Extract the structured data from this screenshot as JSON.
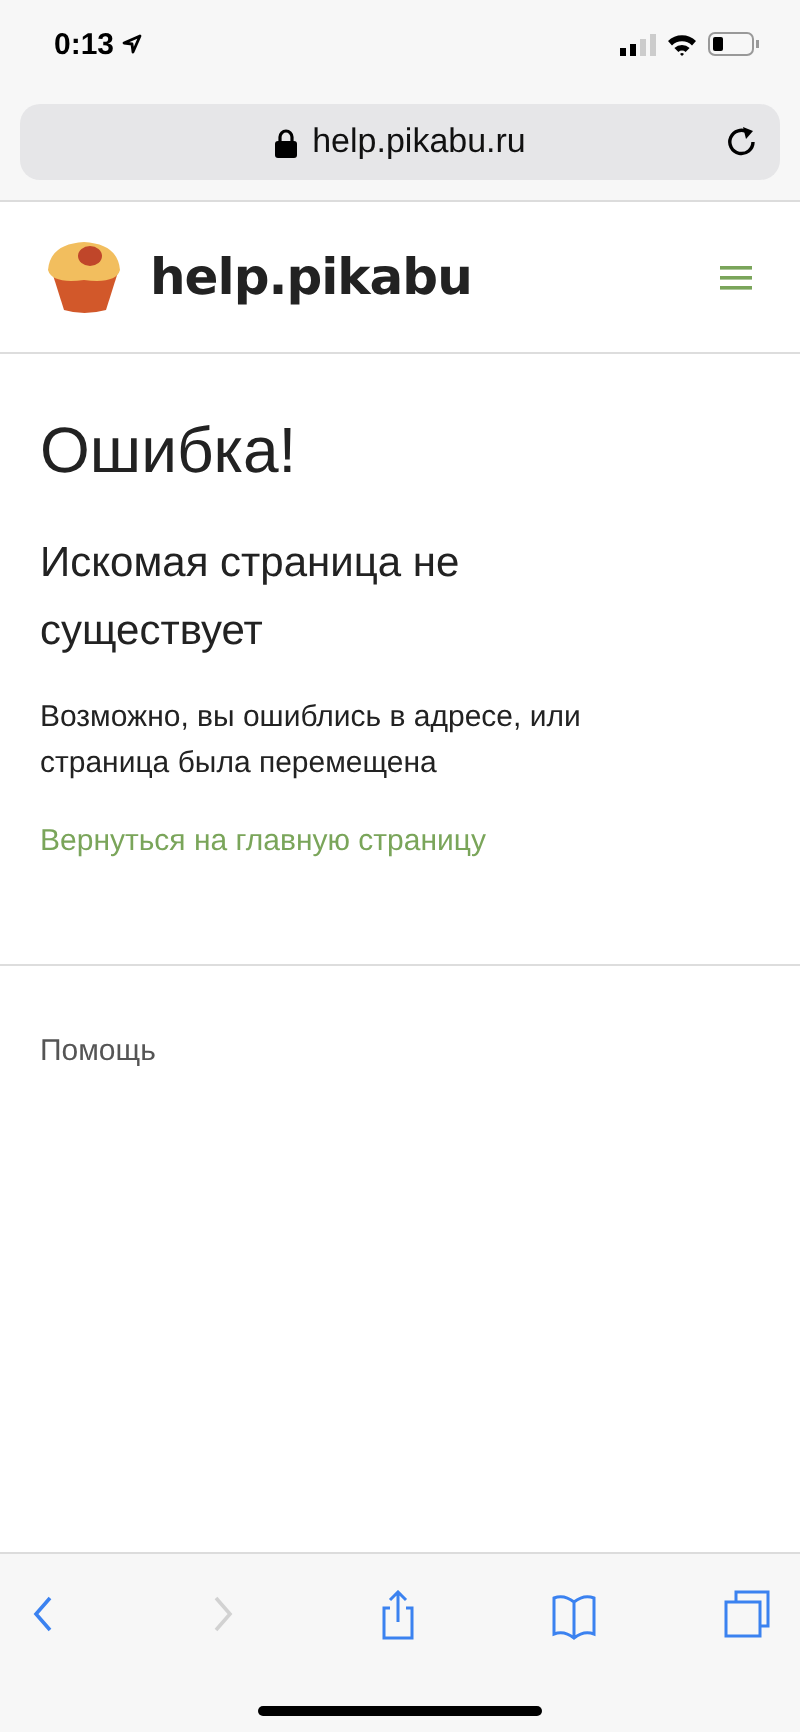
{
  "status_bar": {
    "time": "0:13"
  },
  "address_bar": {
    "url": "help.pikabu.ru"
  },
  "site_header": {
    "title": "help.pikabu"
  },
  "error": {
    "title": "Ошибка!",
    "subtitle": "Искомая страница не существует",
    "message": "Возможно, вы ошиблись в адресе, или страница была перемещена",
    "link": "Вернуться на главную страницу"
  },
  "footer": {
    "label": "Помощь"
  },
  "toolbar": [
    {
      "kind": "back",
      "disabled": false
    },
    {
      "kind": "forward",
      "disabled": true
    },
    {
      "kind": "share",
      "disabled": false
    },
    {
      "kind": "bookmarks",
      "disabled": false
    },
    {
      "kind": "tabs",
      "disabled": false
    }
  ]
}
